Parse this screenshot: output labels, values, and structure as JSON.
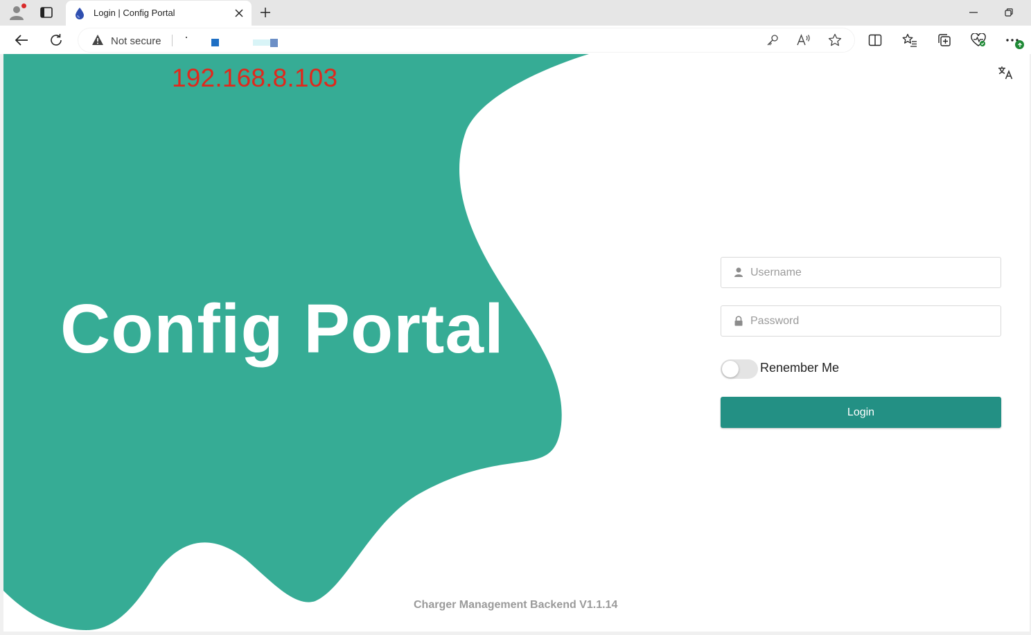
{
  "browser": {
    "tab": {
      "title": "Login | Config Portal",
      "favicon": "droplet-icon"
    },
    "address_bar": {
      "security_label": "Not secure"
    },
    "toolbar_icons": [
      "back-icon",
      "refresh-icon",
      "key-icon",
      "read-aloud-icon",
      "star-icon",
      "split-screen-icon",
      "favorites-icon",
      "collections-icon",
      "browser-essentials-icon",
      "more-icon"
    ]
  },
  "page": {
    "ip_address": "192.168.8.103",
    "hero_title": "Config Portal",
    "login_form": {
      "username_placeholder": "Username",
      "password_placeholder": "Password",
      "remember_label": "Renember Me",
      "remember_checked": false,
      "login_label": "Login"
    },
    "footer": "Charger Management Backend V1.1.14"
  },
  "colors": {
    "brand_teal": "#36ac95",
    "button_teal": "#239084",
    "ip_red": "#e0281c"
  }
}
